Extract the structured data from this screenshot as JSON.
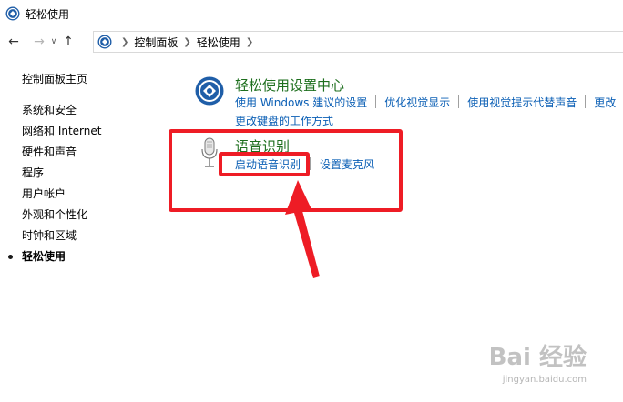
{
  "window": {
    "title": "轻松使用"
  },
  "address_bar": {
    "crumbs": [
      "控制面板",
      "轻松使用"
    ]
  },
  "sidebar": {
    "home": "控制面板主页",
    "items": [
      {
        "label": "系统和安全"
      },
      {
        "label": "网络和 Internet"
      },
      {
        "label": "硬件和声音"
      },
      {
        "label": "程序"
      },
      {
        "label": "用户帐户"
      },
      {
        "label": "外观和个性化"
      },
      {
        "label": "时钟和区域"
      },
      {
        "label": "轻松使用",
        "current": true
      }
    ]
  },
  "ease_center": {
    "title": "轻松使用设置中心",
    "links": [
      "使用 Windows 建议的设置",
      "优化视觉显示",
      "使用视觉提示代替声音",
      "更改"
    ],
    "link2": "更改键盘的工作方式"
  },
  "speech": {
    "title": "语音识别",
    "start_link": "启动语音识别",
    "mic_link": "设置麦克风"
  },
  "watermark": {
    "main": "Bai 经验",
    "sub": "jingyan.baidu.com"
  },
  "colors": {
    "link": "#0b5fb5",
    "section_title": "#1e6f1e",
    "annotation_red": "#ee1c25"
  }
}
